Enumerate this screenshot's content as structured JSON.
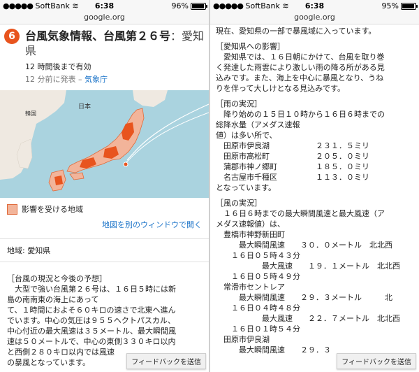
{
  "left": {
    "status": {
      "carrier": "SoftBank",
      "time": "6:38",
      "battery": "96%",
      "battery_level": 0.96
    },
    "url": "google.org",
    "header": {
      "title": "台風気象情報、台風第２６号",
      "location": "愛知県",
      "valid": "12 時間後まで有効",
      "issued_prefix": "12 分前に発表 – ",
      "issuer": "気象庁"
    },
    "map": {
      "label_japan": "日本",
      "label_korea": "韓国"
    },
    "legend": "影響を受ける地域",
    "map_link": "地図を別のウィンドウで開く",
    "region": "地域: 愛知県",
    "body": [
      "［台風の現況と今後の予想］",
      "　大型で強い台風第２６号は、１６日５時には新",
      "島の南南東の海上にあって",
      "て、１時間におよそ６０キロの速さで北東へ進ん",
      "でいます。中心の気圧は９５５ヘクトパスカル、",
      "中心付近の最大風速は３５メートル、最大瞬間風",
      "速は５０メートルで、中心の東側３３０キロ以内",
      "と西側２８０キロ以内では風速",
      "の暴風となっています。"
    ],
    "feedback": "フィードバックを送信"
  },
  "right": {
    "status": {
      "carrier": "SoftBank",
      "time": "6:38",
      "battery": "95%",
      "battery_level": 0.95
    },
    "url": "google.org",
    "body": [
      "現在、愛知県の一部で暴風域に入っています。",
      "",
      "［愛知県への影響］",
      "　愛知県では、１６日朝にかけて、台風を取り巻",
      "く発達した雨雲により激しい雨の降る所がある見",
      "込みです。また、海上を中心に暴風となり、うね",
      "りを伴って大しけとなる見込みです。",
      "",
      "［雨の実況］",
      "　降り始めの１５日１０時から１６日６時までの",
      "総降水量（アメダス速報",
      "値）は多い所で、",
      "　田原市伊良湖　　　　　　２３１．５ミリ",
      "　田原市高松町　　　　　　２０５．０ミリ",
      "　蒲郡市神ノ郷町　　　　　１８５．０ミリ",
      "　名古屋市千種区　　　　　１１３．０ミリ",
      "となっています。",
      "",
      "［風の実況］",
      "　１６日６時までの最大瞬間風速と最大風速（ア",
      "メダス速報値）は、",
      "　豊橋市神野新田町",
      "　　　最大瞬間風速　　３０．０メートル　北北西",
      "　　１６日０５時４３分",
      "　　　　　　最大風速　　１９．１メートル　北北西",
      "　　１６日０５時４９分",
      "　常滑市セントレア",
      "　　　最大瞬間風速　　２９．３メートル　　　北",
      "　　１６日０４時４８分",
      "　　　　　　最大風速　　２２．７メートル　北北西",
      "　　１６日０１時５４分",
      "　田原市伊良湖",
      "　　　最大瞬間風速　　２９．３"
    ],
    "feedback": "フィードバックを送信"
  },
  "colors": {
    "accent": "#e8541e",
    "link": "#1a73c8",
    "affected": "#f2b49a"
  }
}
